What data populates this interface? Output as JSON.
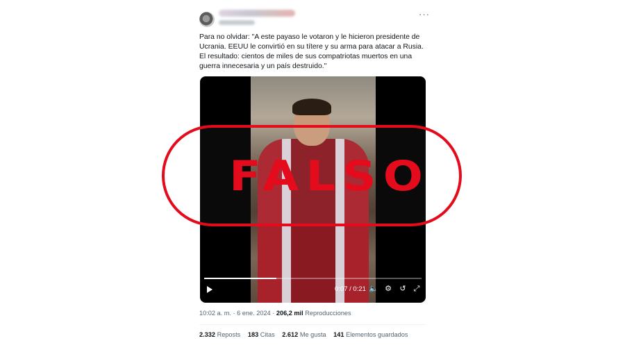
{
  "tweet": {
    "text": "Para no olvidar: \"A este payaso le votaron y le hicieron presidente de Ucrania. EEUU le convirtió en su títere y su arma para atacar a Rusia. El resultado: cientos de miles de sus compatriotas muertos en una guerra innecesaria y un país destruido.\"",
    "more_icon": "ellipsis-icon"
  },
  "video": {
    "current_time": "0:07",
    "duration": "0:21",
    "progress": 0.333,
    "icons": [
      "play-icon",
      "volume-icon",
      "settings-icon",
      "collapse-icon",
      "fullscreen-icon"
    ]
  },
  "stamp": {
    "word": "FALSO",
    "color": "#e30b1c"
  },
  "meta": {
    "timestamp": "10:02 a. m. · 6 ene. 2024 ·",
    "views_count": "206,2 mil",
    "views_label": "Reproducciones"
  },
  "stats": {
    "reposts_count": "2.332",
    "reposts_label": "Reposts",
    "quotes_count": "183",
    "quotes_label": "Citas",
    "likes_count": "2.612",
    "likes_label": "Me gusta",
    "bookmarks_count": "141",
    "bookmarks_label": "Elementos guardados"
  }
}
